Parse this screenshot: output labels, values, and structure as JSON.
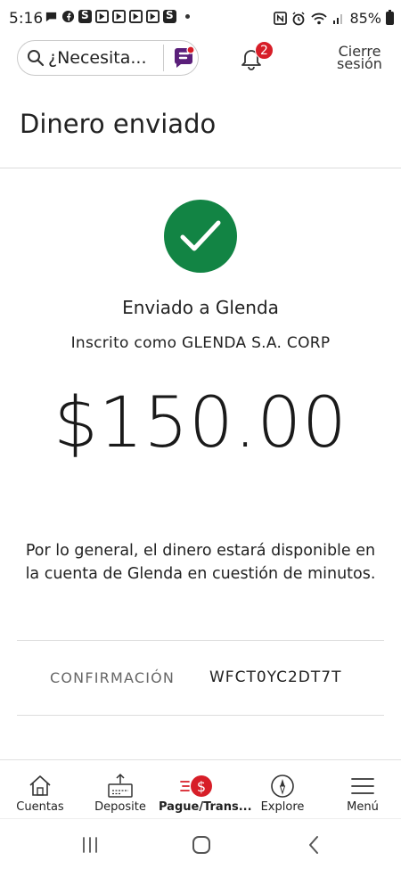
{
  "status_bar": {
    "time": "5:16",
    "battery": "85%",
    "network": "4G"
  },
  "header": {
    "search_placeholder": "¿Necesita...",
    "notification_count": "2",
    "signout_line1": "Cierre",
    "signout_line2": "sesión"
  },
  "page": {
    "title": "Dinero enviado"
  },
  "confirmation": {
    "sent_to": "Enviado a Glenda",
    "enrolled_as": "Inscrito como GLENDA S.A. CORP",
    "amount": "$150.00",
    "availability": "Por lo general, el dinero estará disponible en la cuenta de Glenda en cuestión de minutos.",
    "confirmation_label": "CONFIRMACIÓN",
    "confirmation_code": "WFCT0YC2DT7T"
  },
  "bottom_nav": {
    "items": [
      {
        "label": "Cuentas",
        "icon": "home-icon"
      },
      {
        "label": "Deposite",
        "icon": "deposit-icon"
      },
      {
        "label": "Pague/Trans...",
        "icon": "pay-transfer-icon",
        "active": true
      },
      {
        "label": "Explore",
        "icon": "compass-icon"
      },
      {
        "label": "Menú",
        "icon": "hamburger-menu-icon"
      }
    ]
  },
  "colors": {
    "success_green": "#128444",
    "badge_red": "#d71e28",
    "assistant_purple": "#5a1f7a"
  }
}
